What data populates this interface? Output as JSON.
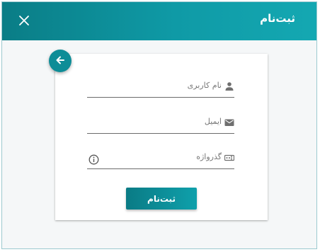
{
  "dialog": {
    "title": "ثبت‌نام",
    "close_icon": "close-icon"
  },
  "form": {
    "back_icon": "arrow-left-icon",
    "username": {
      "label": "نام کاربری",
      "icon": "person-icon",
      "value": ""
    },
    "email": {
      "label": "ایمیل",
      "icon": "mail-icon",
      "value": ""
    },
    "password": {
      "label": "گذرواژه",
      "icon": "password-icon",
      "info_icon": "info-icon",
      "value": ""
    },
    "submit_label": "ثبت‌نام"
  },
  "colors": {
    "header": "#0f9aa6",
    "accent": "#0e8d97",
    "background": "#f5f7f8",
    "card": "#ffffff"
  }
}
